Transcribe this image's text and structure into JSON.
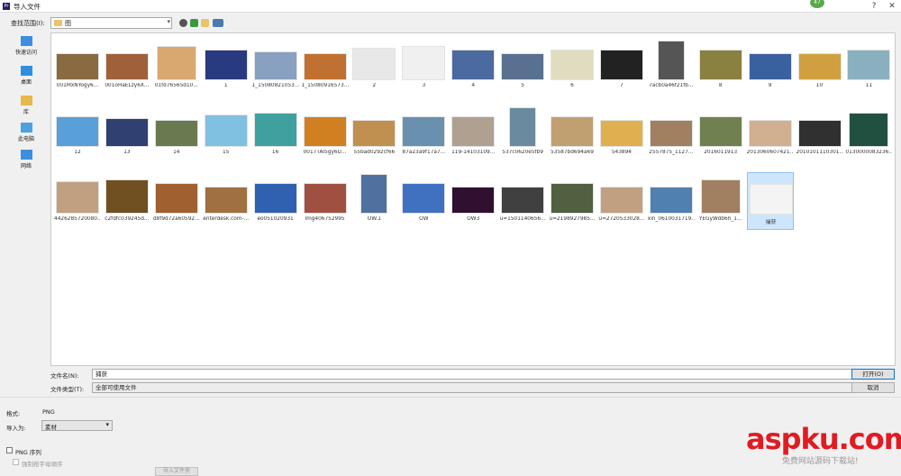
{
  "window": {
    "title": "导入文件",
    "badge": "47"
  },
  "lookin": {
    "label": "查找范围(I):",
    "value": "图"
  },
  "places": [
    {
      "label": "快速访问",
      "icon": "star-icon",
      "color": "#3d8ee0"
    },
    {
      "label": "桌面",
      "icon": "desktop-icon",
      "color": "#2e8fe0"
    },
    {
      "label": "库",
      "icon": "library-icon",
      "color": "#e8b84a"
    },
    {
      "label": "此电脑",
      "icon": "computer-icon",
      "color": "#4aa3df"
    },
    {
      "label": "网络",
      "icon": "network-icon",
      "color": "#3d8ee0"
    }
  ],
  "rows": [
    [
      {
        "name": "001MxNYogy6...",
        "color": "#8a6a40"
      },
      {
        "name": "001oHaELzy6X...",
        "color": "#a0603a"
      },
      {
        "name": "01fd76565d10...",
        "color": "#d9a870"
      },
      {
        "name": "1",
        "color": "#2a3a80"
      },
      {
        "name": "1_15080821053...",
        "color": "#8aa0c0"
      },
      {
        "name": "1_15080916573...",
        "color": "#c07030"
      },
      {
        "name": "2",
        "color": "#e8e8e8"
      },
      {
        "name": "3",
        "color": "#f0f0f0"
      },
      {
        "name": "4",
        "color": "#4a6aa0"
      },
      {
        "name": "5",
        "color": "#5a7090"
      },
      {
        "name": "6",
        "color": "#e0dcc0"
      },
      {
        "name": "7",
        "color": "#222222"
      },
      {
        "name": "7acb0a46f21fb...",
        "color": "#555555"
      },
      {
        "name": "8",
        "color": "#8a8040"
      },
      {
        "name": "9",
        "color": "#3a60a0"
      },
      {
        "name": "10",
        "color": "#d0a040"
      },
      {
        "name": "11",
        "color": "#8ab0c0"
      }
    ],
    [
      {
        "name": "12",
        "color": "#5aa0d8"
      },
      {
        "name": "13",
        "color": "#304070"
      },
      {
        "name": "14",
        "color": "#6a7a50"
      },
      {
        "name": "15",
        "color": "#80c0e0"
      },
      {
        "name": "16",
        "color": "#40a0a0"
      },
      {
        "name": "0017TAI5gy6U...",
        "color": "#d08020"
      },
      {
        "name": "55bad0292cf66",
        "color": "#c09050"
      },
      {
        "name": "87a23a9f17a7...",
        "color": "#6a90b0"
      },
      {
        "name": "119-14103109...",
        "color": "#b0a090"
      },
      {
        "name": "537c0620e5fb9",
        "color": "#6a8aa0"
      },
      {
        "name": "53587bd694a69",
        "color": "#c0a070"
      },
      {
        "name": "543894",
        "color": "#e0b050"
      },
      {
        "name": "2557875_1127...",
        "color": "#a08060"
      },
      {
        "name": "2016011913",
        "color": "#708050"
      },
      {
        "name": "2013060607421...",
        "color": "#d0b090"
      },
      {
        "name": "2010101110301...",
        "color": "#303030"
      },
      {
        "name": "0130000083236...",
        "color": "#205040"
      }
    ],
    [
      {
        "name": "4426285720080...",
        "color": "#c0a080"
      },
      {
        "name": "c2fdfc039245d...",
        "color": "#705020"
      },
      {
        "name": "d8f9d72a60592...",
        "color": "#a06030"
      },
      {
        "name": "enterdesk.com-...",
        "color": "#a07040"
      },
      {
        "name": "eo051020931",
        "color": "#3060b0"
      },
      {
        "name": "Img406752995",
        "color": "#a05040"
      },
      {
        "name": "OW.1",
        "color": "#5070a0"
      },
      {
        "name": "OW",
        "color": "#4070c0"
      },
      {
        "name": "OW3",
        "color": "#301030"
      },
      {
        "name": "u=1501140656...",
        "color": "#404040"
      },
      {
        "name": "u=2198927985...",
        "color": "#506040"
      },
      {
        "name": "u=2720533028...",
        "color": "#c0a080"
      },
      {
        "name": "xin_0610031719...",
        "color": "#5080b0"
      },
      {
        "name": "YEGyWdb6h_1...",
        "color": "#a08060"
      },
      {
        "name": "捕获",
        "color": "#f4f4f4",
        "selected": true
      }
    ]
  ],
  "filename": {
    "label": "文件名(N):",
    "value": "捕获"
  },
  "filetype": {
    "label": "文件类型(T):",
    "value": "全部可使用文件"
  },
  "buttons": {
    "open": "打开(O)",
    "cancel": "取消"
  },
  "bottom": {
    "format_label": "格式:",
    "format_value": "PNG",
    "import_as_label": "导入为:",
    "import_as_value": "素材",
    "png_sequence": "PNG 序列",
    "force_alpha": "强制按字母顺序",
    "import_folder": "导入文件夹"
  },
  "watermark": {
    "logo": "aspku.com",
    "sub": "免费网站源码下载站!"
  }
}
